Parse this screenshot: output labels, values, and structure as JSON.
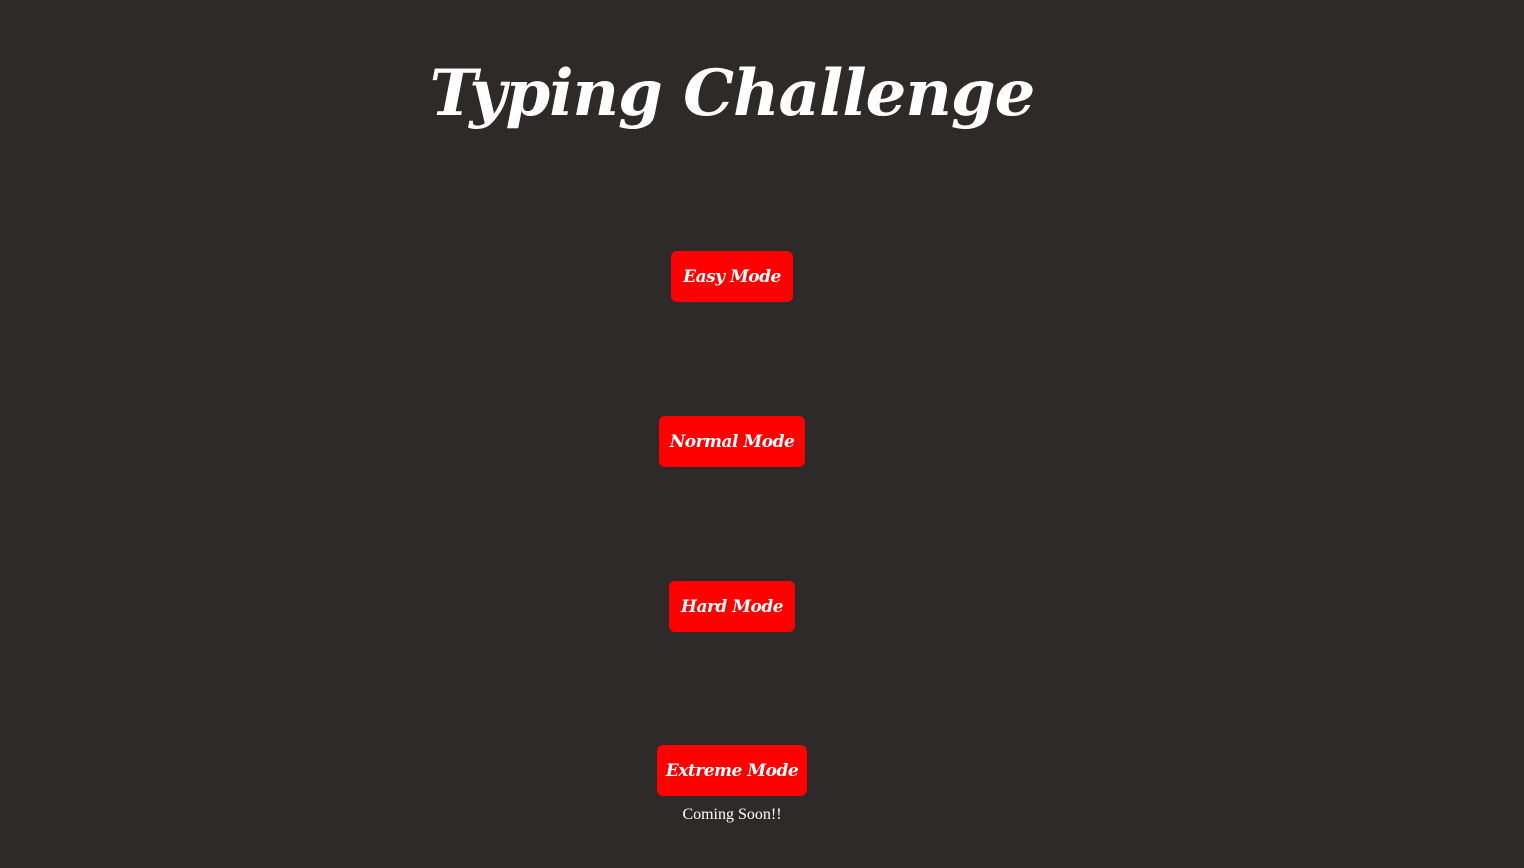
{
  "header": {
    "title": "Typing Challenge"
  },
  "modes": [
    {
      "label": "Easy Mode"
    },
    {
      "label": "Normal Mode"
    },
    {
      "label": "Hard Mode"
    },
    {
      "label": "Extreme Mode"
    }
  ],
  "extreme_note": "Coming Soon!!",
  "colors": {
    "background": "#2f2a2a",
    "button": "#ff0000",
    "text": "#ffffff"
  }
}
